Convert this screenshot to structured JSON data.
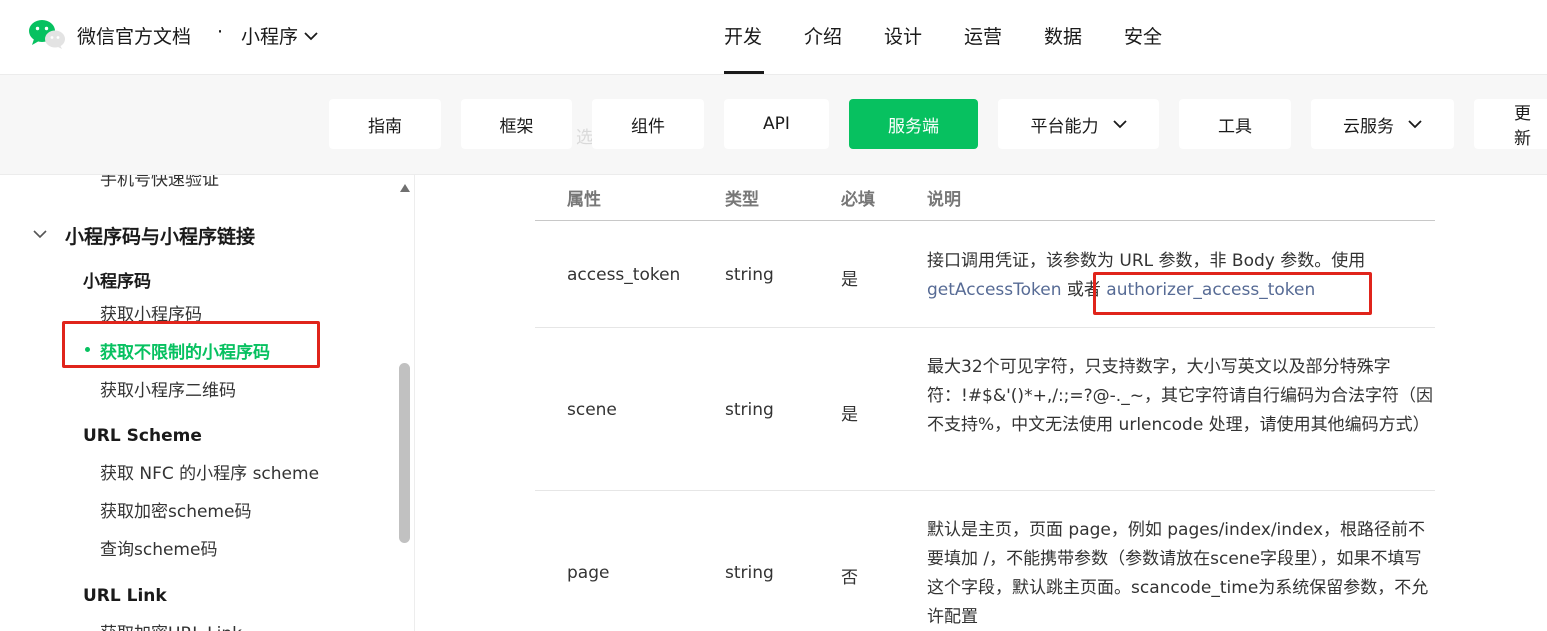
{
  "header": {
    "site_title": "微信官方文档",
    "separator": "·",
    "product": "小程序",
    "nav": [
      "开发",
      "介绍",
      "设计",
      "运营",
      "数据",
      "安全"
    ],
    "active_nav": "开发"
  },
  "subnav": {
    "buttons": [
      "指南",
      "框架",
      "组件",
      "API",
      "服务端",
      "平台能力",
      "工具",
      "云服务",
      "更新"
    ],
    "active": "服务端",
    "ghost_text": "选"
  },
  "sidebar": {
    "cut_item": "手机号快速验证",
    "group_title": "小程序码与小程序链接",
    "sections": [
      {
        "title": "小程序码",
        "items": [
          "获取小程序码",
          "获取不限制的小程序码",
          "获取小程序二维码"
        ]
      },
      {
        "title": "URL Scheme",
        "items": [
          "获取 NFC 的小程序 scheme",
          "获取加密scheme码",
          "查询scheme码"
        ]
      },
      {
        "title": "URL Link",
        "items": [
          "获取加密URL Link"
        ]
      }
    ],
    "active_item": "获取不限制的小程序码"
  },
  "table": {
    "headers": [
      "属性",
      "类型",
      "必填",
      "说明"
    ],
    "rows": [
      {
        "name": "access_token",
        "type": "string",
        "required": "是",
        "desc_text": "接口调用凭证，该参数为 URL 参数，非 Body 参数。使用",
        "link1": "getAccessToken",
        "or_text": " 或者 ",
        "link2": "authorizer_access_token"
      },
      {
        "name": "scene",
        "type": "string",
        "required": "是",
        "desc": "最大32个可见字符，只支持数字，大小写英文以及部分特殊字符：!#$&'()*+,/:;=?@-._~，其它字符请自行编码为合法字符（因不支持%，中文无法使用 urlencode 处理，请使用其他编码方式）"
      },
      {
        "name": "page",
        "type": "string",
        "required": "否",
        "desc": "默认是主页，页面 page，例如 pages/index/index，根路径前不要填加 /，不能携带参数（参数请放在scene字段里），如果不填写这个字段，默认跳主页面。scancode_time为系统保留参数，不允许配置"
      }
    ]
  },
  "colors": {
    "accent": "#07c160",
    "link": "#576b95",
    "highlight": "#e0241b"
  }
}
